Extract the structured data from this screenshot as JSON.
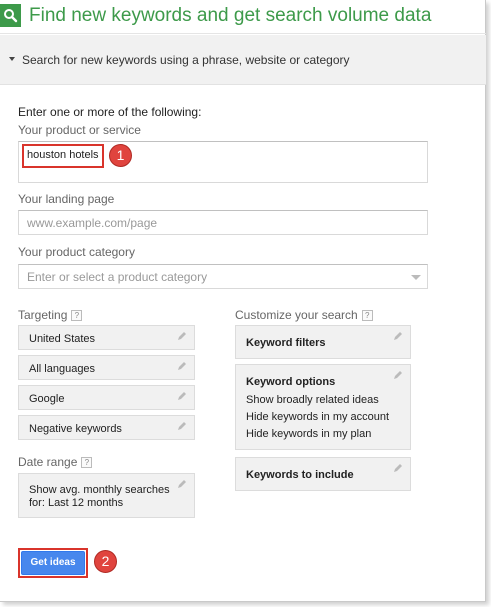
{
  "header": {
    "title": "Find new keywords and get search volume data",
    "icon": "search-icon",
    "accent": "#3d9a4a"
  },
  "section": {
    "label": "Search for new keywords using a phrase, website or category"
  },
  "form": {
    "intro": "Enter one or more of the following:",
    "product_label": "Your product or service",
    "product_value": "houston hotels",
    "landing_label": "Your landing page",
    "landing_placeholder": "www.example.com/page",
    "category_label": "Your product category",
    "category_placeholder": "Enter or select a product category"
  },
  "targeting": {
    "label": "Targeting",
    "help": "?",
    "items": [
      "United States",
      "All languages",
      "Google",
      "Negative keywords"
    ]
  },
  "date_range": {
    "label": "Date range",
    "help": "?",
    "line1": "Show avg. monthly searches",
    "line2": "for: Last 12 months"
  },
  "customize": {
    "label": "Customize your search",
    "help": "?",
    "keyword_filters": "Keyword filters",
    "keyword_options": {
      "title": "Keyword options",
      "lines": [
        "Show broadly related ideas",
        "Hide keywords in my account",
        "Hide keywords in my plan"
      ]
    },
    "keywords_to_include": "Keywords to include"
  },
  "button": {
    "label": "Get ideas",
    "color": "#4787ed"
  },
  "annotations": {
    "badge1": "1",
    "badge2": "2",
    "highlight_color": "#d9342b"
  }
}
